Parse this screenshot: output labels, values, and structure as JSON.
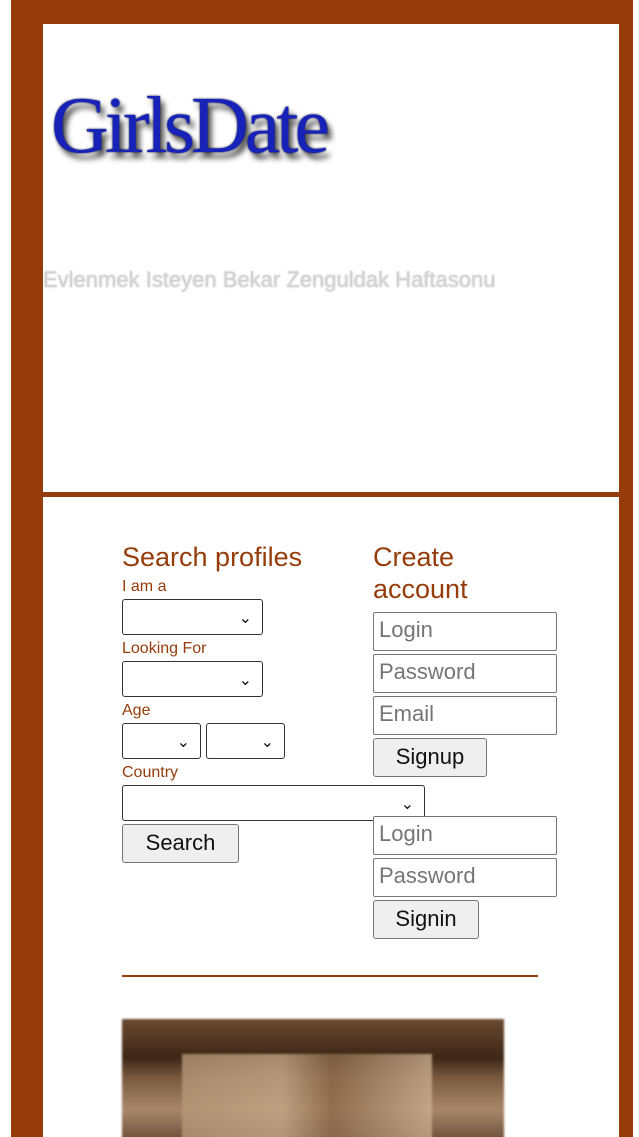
{
  "header": {
    "logo_text": "GirlsDate",
    "tagline": "Evlenmek Isteyen Bekar Zenguldak Haftasonu"
  },
  "search": {
    "title": "Search profiles",
    "iam_label": "I am a",
    "looking_for_label": "Looking For",
    "age_label": "Age",
    "country_label": "Country",
    "search_button": "Search"
  },
  "signup": {
    "title": "Create account",
    "login_placeholder": "Login",
    "password_placeholder": "Password",
    "email_placeholder": "Email",
    "signup_button": "Signup"
  },
  "signin": {
    "login_placeholder": "Login",
    "password_placeholder": "Password",
    "signin_button": "Signin"
  },
  "colors": {
    "brand": "#963c0a",
    "logo": "#1722b8"
  }
}
